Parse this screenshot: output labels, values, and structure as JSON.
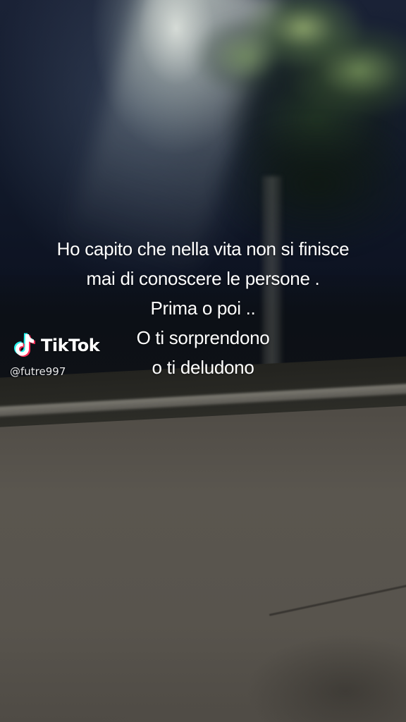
{
  "caption": {
    "lines": [
      "Ho capito che nella vita non si finisce",
      "mai di conoscere le persone .",
      "Prima o poi ..",
      "O ti sorprendono",
      "o ti deludono"
    ]
  },
  "watermark": {
    "brand": "TikTok",
    "handle": "@futre997",
    "icon": "tiktok-logo-icon",
    "colors": {
      "cyan": "#25f4ee",
      "red": "#fe2c55",
      "white": "#ffffff"
    }
  }
}
